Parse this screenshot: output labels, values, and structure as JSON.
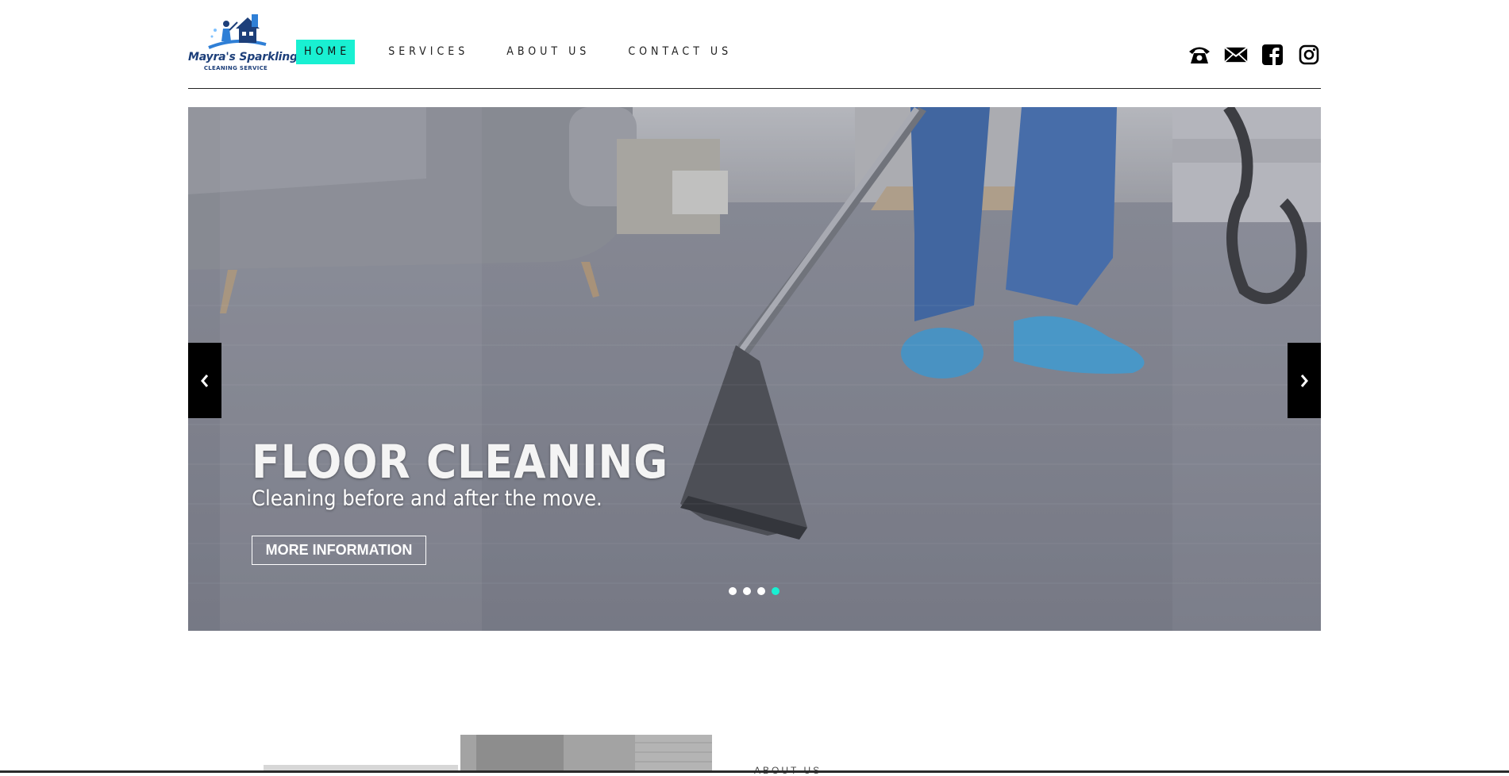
{
  "brand": {
    "name": "Mayra's Sparkling",
    "tagline": "CLEANING SERVICE"
  },
  "nav": {
    "items": [
      "HOME",
      "SERVICES",
      "ABOUT US",
      "CONTACT US"
    ],
    "active_index": 0
  },
  "social": {
    "icons": [
      "phone-icon",
      "mail-icon",
      "facebook-icon",
      "instagram-icon"
    ]
  },
  "slider": {
    "title": "FLOOR CLEANING",
    "subtitle": "Cleaning before and after the move.",
    "button_label": "MORE INFORMATION",
    "dot_count": 4,
    "active_dot": 3,
    "accent_color": "#19f0d2"
  },
  "lower": {
    "heading": "ABOUT US"
  }
}
